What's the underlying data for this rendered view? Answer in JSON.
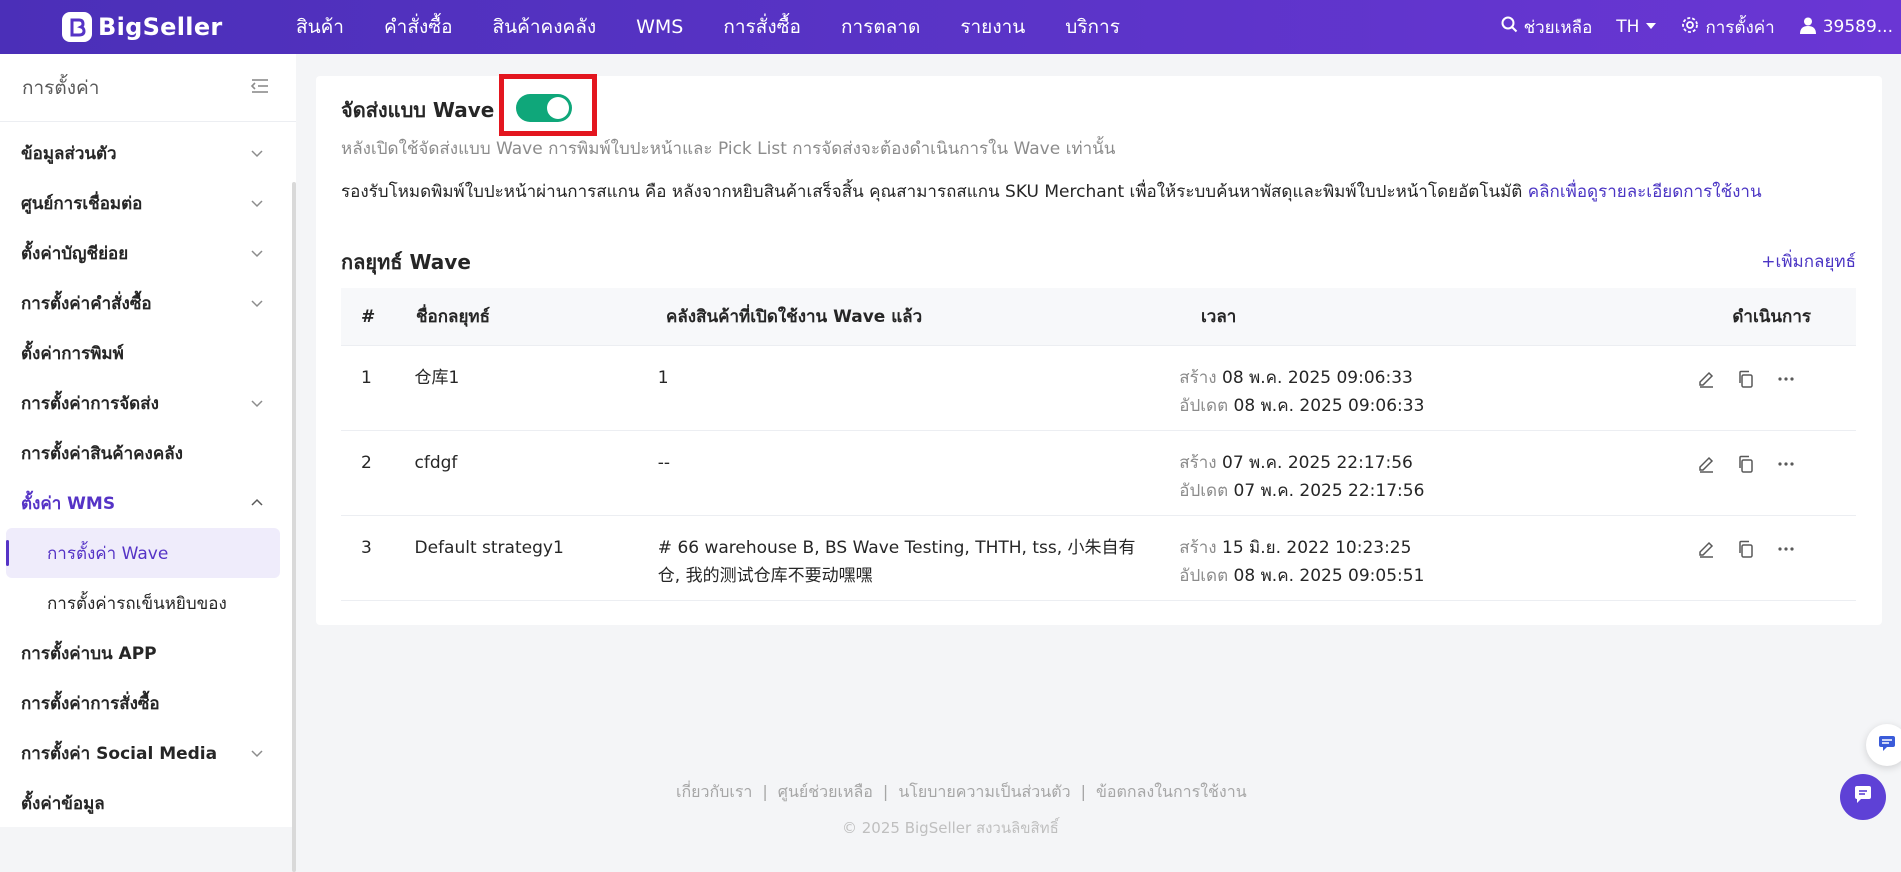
{
  "brand": {
    "name": "BigSeller"
  },
  "nav": {
    "items": [
      "สินค้า",
      "คำสั่งซื้อ",
      "สินค้าคงคลัง",
      "WMS",
      "การสั่งซื้อ",
      "การตลาด",
      "รายงาน",
      "บริการ"
    ]
  },
  "topright": {
    "help": "ช่วยเหลือ",
    "lang": "TH",
    "settings": "การตั้งค่า",
    "user": "39589..."
  },
  "sidebar": {
    "title": "การตั้งค่า",
    "items": [
      {
        "label": "ข้อมูลส่วนตัว",
        "chevron": "down"
      },
      {
        "label": "ศูนย์การเชื่อมต่อ",
        "chevron": "down"
      },
      {
        "label": "ตั้งค่าบัญชีย่อย",
        "chevron": "down"
      },
      {
        "label": "การตั้งค่าคำสั่งซื้อ",
        "chevron": "down"
      },
      {
        "label": "ตั้งค่าการพิมพ์",
        "chevron": ""
      },
      {
        "label": "การตั้งค่าการจัดส่ง",
        "chevron": "down"
      },
      {
        "label": "การตั้งค่าสินค้าคงคลัง",
        "chevron": ""
      },
      {
        "label": "ตั้งค่า WMS",
        "chevron": "up"
      },
      {
        "label": "การตั้งค่า Wave",
        "sub": true,
        "selected": true
      },
      {
        "label": "การตั้งค่ารถเข็นหยิบของ",
        "sub": true
      },
      {
        "label": "การตั้งค่าบน APP",
        "chevron": ""
      },
      {
        "label": "การตั้งค่าการสั่งซื้อ",
        "chevron": ""
      },
      {
        "label": "การตั้งค่า Social Media",
        "chevron": "down"
      },
      {
        "label": "ตั้งค่าข้อมูล",
        "chevron": ""
      }
    ]
  },
  "wave": {
    "title": "จัดส่งแบบ Wave",
    "enabled": true,
    "desc1": "หลังเปิดใช้จัดส่งแบบ Wave การพิมพ์ใบปะหน้าและ Pick List การจัดส่งจะต้องดำเนินการใน Wave เท่านั้น",
    "desc2": "รองรับโหมดพิมพ์ใบปะหน้าผ่านการสแกน คือ หลังจากหยิบสินค้าเสร็จสิ้น คุณสามารถสแกน SKU Merchant เพื่อให้ระบบค้นหาพัสดุและพิมพ์ใบปะหน้าโดยอัตโนมัติ",
    "desc2_link": "คลิกเพื่อดูรายละเอียดการใช้งาน"
  },
  "strategy": {
    "title": "กลยุทธ์ Wave",
    "add": "+เพิ่มกลยุทธ์",
    "columns": [
      "#",
      "ชื่อกลยุทธ์",
      "คลังสินค้าที่เปิดใช้งาน Wave แล้ว",
      "เวลา",
      "ดำเนินการ"
    ],
    "created_label": "สร้าง",
    "updated_label": "อัปเดต",
    "rows": [
      {
        "no": "1",
        "name": "仓库1",
        "warehouses": "1",
        "created": "08 พ.ค. 2025 09:06:33",
        "updated": "08 พ.ค. 2025 09:06:33"
      },
      {
        "no": "2",
        "name": "cfdgf",
        "warehouses": "--",
        "created": "07 พ.ค. 2025 22:17:56",
        "updated": "07 พ.ค. 2025 22:17:56"
      },
      {
        "no": "3",
        "name": "Default strategy1",
        "warehouses": "# 66 warehouse B, BS Wave Testing, THTH, tss, 小朱自有仓, 我的测试仓库不要动嘿嘿",
        "created": "15 มิ.ย. 2022 10:23:25",
        "updated": "08 พ.ค. 2025 09:05:51"
      }
    ]
  },
  "footer": {
    "links": [
      "เกี่ยวกับเรา",
      "ศูนย์ช่วยเหลือ",
      "นโยบายความเป็นส่วนตัว",
      "ข้อตกลงในการใช้งาน"
    ],
    "copyright": "© 2025 BigSeller สงวนลิขสิทธิ์"
  },
  "colors": {
    "brand": "#5533c6",
    "toggle_on": "#0fa77a",
    "highlight": "#e3161f"
  }
}
